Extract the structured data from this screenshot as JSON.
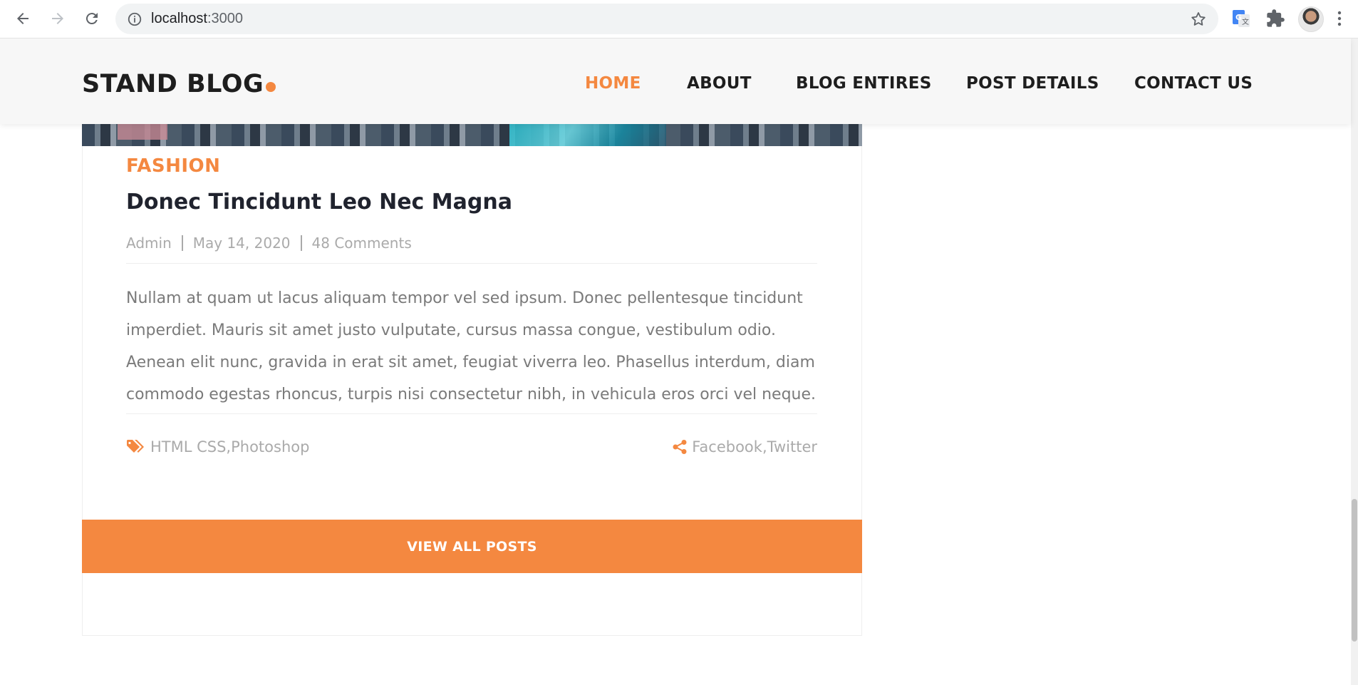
{
  "browser": {
    "url_host": "localhost",
    "url_port": ":3000",
    "icons": {
      "back": "arrow-left-icon",
      "forward": "arrow-right-icon",
      "reload": "reload-icon",
      "info": "info-icon",
      "bookmark": "star-icon",
      "translate": "google-translate-icon",
      "extensions": "puzzle-icon",
      "menu": "kebab-menu-icon"
    }
  },
  "site": {
    "logo_text": "STAND BLOG",
    "accent_color": "#f48840",
    "nav": [
      {
        "label": "HOME",
        "active": true
      },
      {
        "label": "ABOUT",
        "active": false
      },
      {
        "label": "BLOG ENTIRES",
        "active": false
      },
      {
        "label": "POST DETAILS",
        "active": false
      },
      {
        "label": "CONTACT US",
        "active": false
      }
    ]
  },
  "post": {
    "category": "FASHION",
    "title": "Donec Tincidunt Leo Nec Magna",
    "meta": {
      "author": "Admin",
      "date": "May 14, 2020",
      "comments": "48 Comments"
    },
    "body": "Nullam at quam ut lacus aliquam tempor vel sed ipsum. Donec pellentesque tincidunt imperdiet. Mauris sit amet justo vulputate, cursus massa congue, vestibulum odio. Aenean elit nunc, gravida in erat sit amet, feugiat viverra leo. Phasellus interdum, diam commodo egestas rhoncus, turpis nisi consectetur nibh, in vehicula eros orci vel neque.",
    "tags": "HTML CSS,Photoshop",
    "share": "Facebook,Twitter"
  },
  "view_all_label": "VIEW ALL POSTS"
}
